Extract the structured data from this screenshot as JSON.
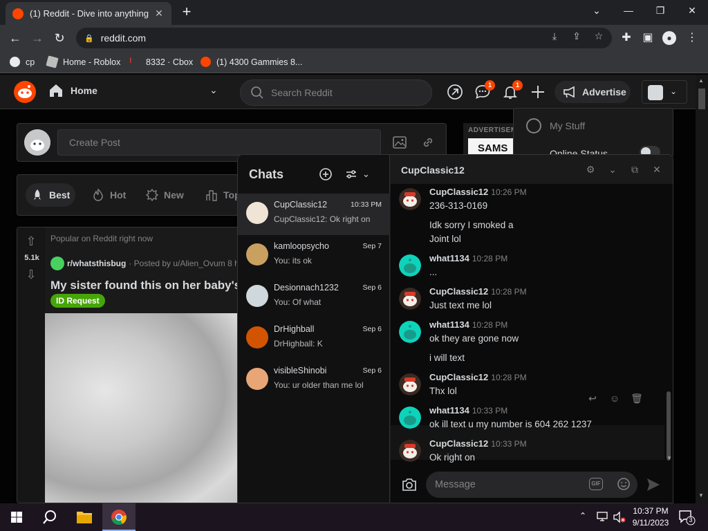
{
  "browser": {
    "tab_title": "(1) Reddit - Dive into anything",
    "url": "reddit.com",
    "bookmarks": [
      {
        "label": "cp"
      },
      {
        "label": "Home - Roblox"
      },
      {
        "label": "8332 · Cbox"
      },
      {
        "label": "(1) 4300 Gammies 8..."
      }
    ]
  },
  "header": {
    "home_label": "Home",
    "search_placeholder": "Search Reddit",
    "chat_badge": "1",
    "notif_badge": "1",
    "advertise_label": "Advertise"
  },
  "feed": {
    "create_post_placeholder": "Create Post",
    "sort_tabs": [
      {
        "label": "Best",
        "active": true
      },
      {
        "label": "Hot"
      },
      {
        "label": "New"
      },
      {
        "label": "Top"
      }
    ],
    "post": {
      "score": "5.1k",
      "context": "Popular on Reddit right now",
      "subreddit": "r/whatsthisbug",
      "posted_by": "· Posted by u/Alien_Ovum 8 h",
      "title": "My sister found this on her baby's",
      "flair": "ID Request"
    }
  },
  "sidebar": {
    "ad_label": "ADVERTISEMENT",
    "ad_text": "SAMS"
  },
  "user_menu": {
    "my_stuff": "My Stuff",
    "online_status": "Online Status"
  },
  "chat": {
    "list_title": "Chats",
    "rows": [
      {
        "name": "CupClassic12",
        "date": "10:33 PM",
        "preview": "CupClassic12: Ok right on",
        "selected": true,
        "avatar_color": "#f0e4d6"
      },
      {
        "name": "kamloopsycho",
        "date": "Sep 7",
        "preview": "You: its ok",
        "avatar_color": "#c8a060"
      },
      {
        "name": "Desionnach1232",
        "date": "Sep 6",
        "preview": "You: Of what",
        "avatar_color": "#cfd8dc"
      },
      {
        "name": "DrHighball",
        "date": "Sep 6",
        "preview": "DrHighball: K",
        "avatar_color": "#d35400"
      },
      {
        "name": "visibleShinobi",
        "date": "Sep 6",
        "preview": "You: ur older than me lol",
        "avatar_color": "#e8a676"
      }
    ],
    "convo_title": "CupClassic12",
    "messages": [
      {
        "author": "CupClassic12",
        "time": "10:26 PM",
        "avatar": "cup",
        "lines": [
          "236-313-0169",
          "Idk sorry I smoked a",
          "Joint lol"
        ]
      },
      {
        "author": "what1134",
        "time": "10:28 PM",
        "avatar": "teal",
        "lines": [
          "..."
        ]
      },
      {
        "author": "CupClassic12",
        "time": "10:28 PM",
        "avatar": "cup",
        "lines": [
          "Just text me lol"
        ]
      },
      {
        "author": "what1134",
        "time": "10:28 PM",
        "avatar": "teal",
        "lines": [
          "ok they are gone now",
          "i will text"
        ]
      },
      {
        "author": "CupClassic12",
        "time": "10:28 PM",
        "avatar": "cup",
        "lines": [
          "Thx lol"
        ]
      },
      {
        "author": "what1134",
        "time": "10:33 PM",
        "avatar": "teal",
        "lines": [
          "ok ill text u my number is 604 262 1237"
        ]
      },
      {
        "author": "CupClassic12",
        "time": "10:33 PM",
        "avatar": "cup",
        "lines": [
          "Ok right on"
        ]
      }
    ],
    "message_placeholder": "Message",
    "gif_label": "GIF"
  },
  "taskbar": {
    "time": "10:37 PM",
    "date": "9/11/2023",
    "notification_count": "3"
  },
  "colors": {
    "reddit_orange": "#ff4500",
    "teal_avatar": "#0dd3bb",
    "flair_green": "#46a508"
  }
}
